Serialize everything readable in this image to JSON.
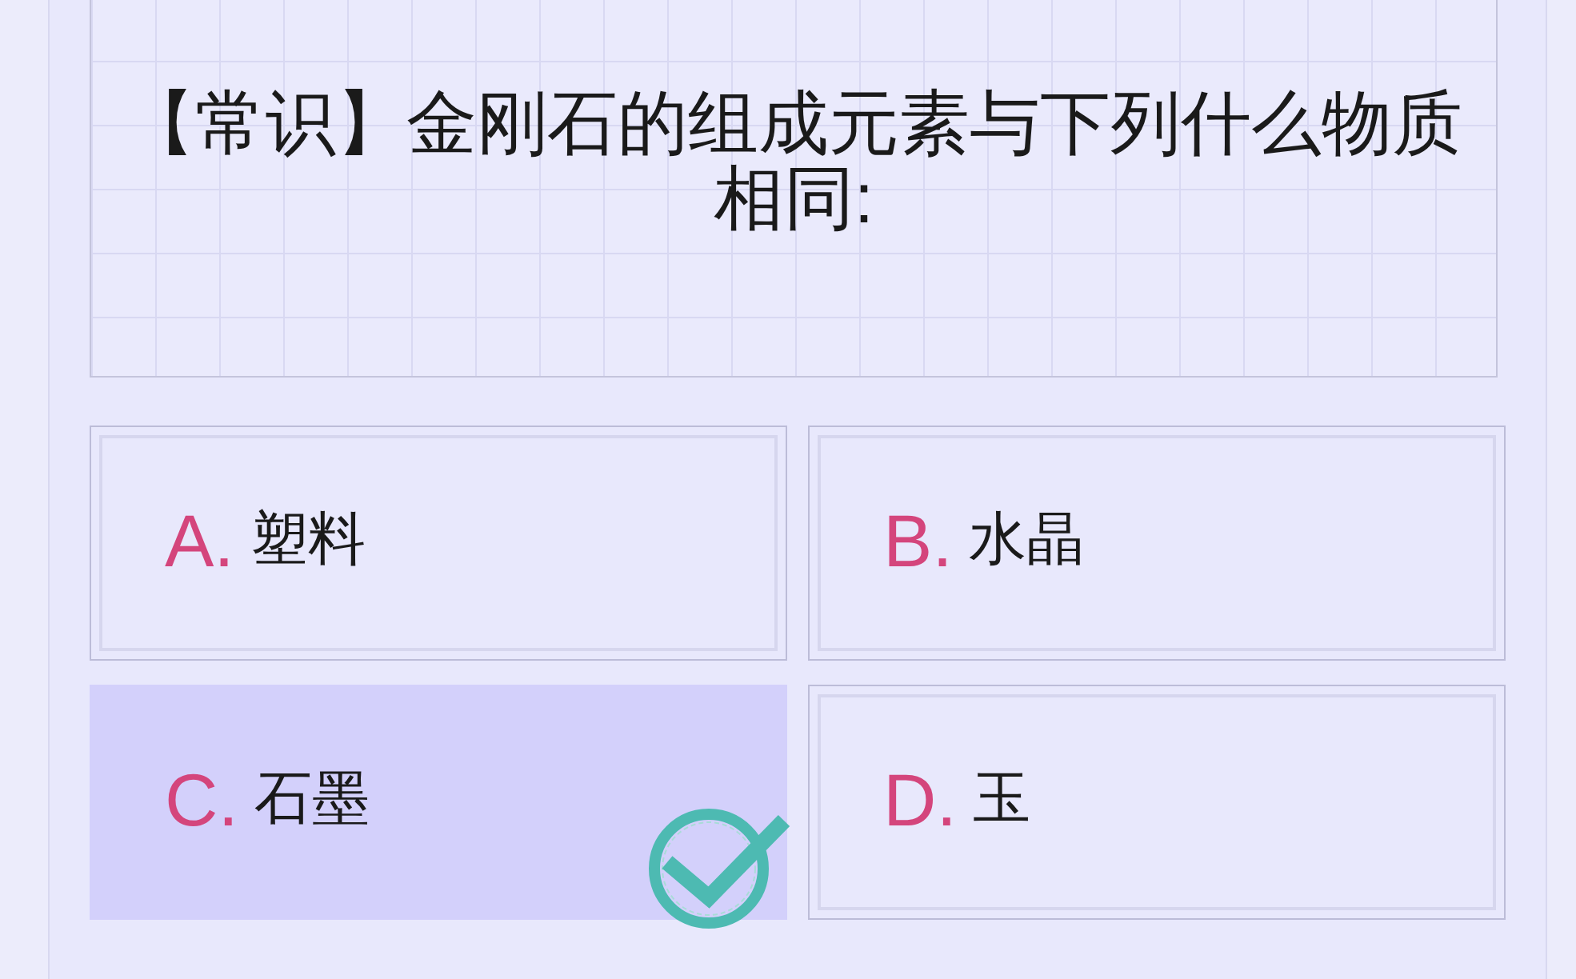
{
  "question": {
    "text": "【常识】金刚石的组成元素与下列什么物质相同:"
  },
  "options": [
    {
      "letter": "A.",
      "text": "塑料",
      "selected": false,
      "correct": false
    },
    {
      "letter": "B.",
      "text": "水晶",
      "selected": false,
      "correct": false
    },
    {
      "letter": "C.",
      "text": "石墨",
      "selected": true,
      "correct": true
    },
    {
      "letter": "D.",
      "text": "玉",
      "selected": false,
      "correct": false
    }
  ]
}
